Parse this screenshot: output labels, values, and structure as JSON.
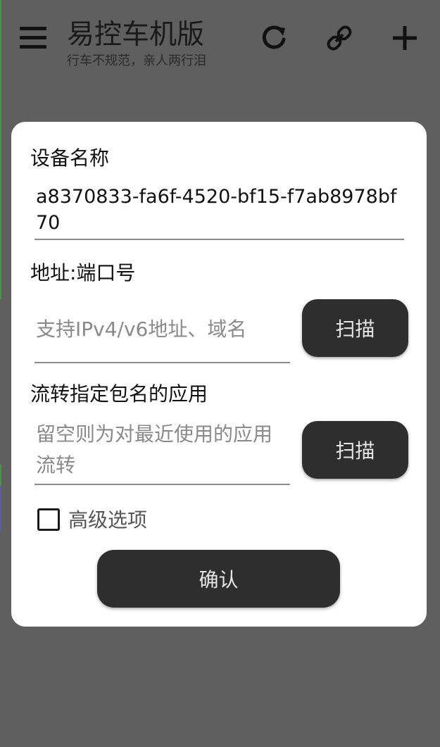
{
  "appbar": {
    "title": "易控车机版",
    "subtitle": "行车不规范，亲人两行泪"
  },
  "icons": {
    "menu": "menu-icon",
    "refresh": "refresh-icon",
    "link": "link-icon",
    "add": "add-icon"
  },
  "dialog": {
    "name_label": "设备名称",
    "name_value": "a8370833-fa6f-4520-bf15-f7ab8978bf70",
    "address_label": "地址:端口号",
    "address_placeholder": "支持IPv4/v6地址、域名",
    "scan_label": "扫描",
    "app_label": "流转指定包名的应用",
    "app_placeholder": "留空则为对最近使用的应用流转",
    "app_scan_label": "扫描",
    "advanced_label": "高级选项",
    "advanced_checked": false,
    "confirm_label": "确认"
  }
}
